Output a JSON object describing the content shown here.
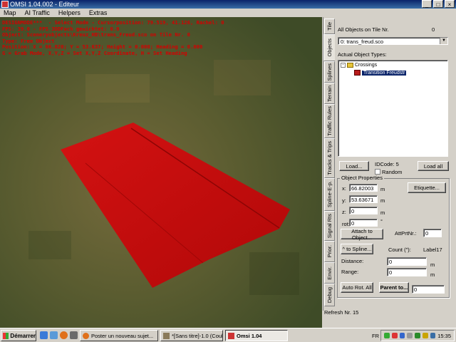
{
  "window": {
    "title": "OMSI 1.04.002 - Editeur",
    "minimize": "_",
    "maximize": "□",
    "close": "×"
  },
  "menu": [
    "Map",
    "AI Traffic",
    "Helpers",
    "Extras"
  ],
  "overlay": {
    "lines": [
      "DESIGNMODE***  - Select Mode - Cursorposition: 79.519, 41.126, Rachel: 0",
      "FPS: 39.0 - FPS 3DDFach gewichtet: 0.0",
      "Object: Sceneryobjects\\Kreuz_HB\\trans_Freud.sco on Tile Nr. 0",
      "Type: Free Object",
      "Position: X = 66.820; Y = 53.637; Height = 0.000; Heading = 0.000",
      "G = Grab Mode, X,Y,Z = Set X,Y,Z Coordinate, H = Set Heading"
    ]
  },
  "tabs": [
    "Tile",
    "Objects",
    "Splines",
    "Terrain",
    "Traffic Rules",
    "Tracks & Trips",
    "Spline-E-p.",
    "Signal Rts",
    "Prior.",
    "Envir.",
    "Debug"
  ],
  "panel": {
    "all_objects_label": "All Objects on Tile Nr.",
    "tile_number": "0",
    "object_combo": "0: trans_freud.sco",
    "actual_types_label": "Actual Object Types:",
    "tree": {
      "folder": "Crossings",
      "folder_expander": "-",
      "item": "Transition Freudstr"
    },
    "load_button": "Load...",
    "idcode_label": "IDCode: 5",
    "random_label": "Random",
    "load_all_button": "Load all",
    "props_title": "Object Properties",
    "x_label": "x:",
    "x_value": "66.82003",
    "y_label": "y:",
    "y_value": "53.63671",
    "z_label": "z:",
    "z_value": "0",
    "rot_label": "rot:",
    "rot_value": "0",
    "unit_m": "m",
    "unit_deg": "°",
    "etiquette_button": "Etiquette...",
    "attach_button": "Attach to Object...",
    "att_prt_label": "AttPrtNr.:",
    "att_prt_value": "0",
    "to_spline_button": "^ to Spline...",
    "count_label": "Count (\"):",
    "label17": "Label17",
    "distance_label": "Distance:",
    "distance_value": "0",
    "range_label": "Range:",
    "range_value": "0",
    "auto_rot_button": "Auto Rot. All",
    "parent_button": "Parent to...",
    "parent_value": "0",
    "refresh_label": "Refresh Nr. 15"
  },
  "taskbar": {
    "start": "Démarrer",
    "tasks": [
      {
        "label": "Poster un nouveau sujet..."
      },
      {
        "label": "*[Sans titre]-1.0 (Couleu..."
      },
      {
        "label": "Omsi 1.04"
      }
    ],
    "lang": "FR",
    "clock": "15:35"
  },
  "colors": {
    "object_red": "#c40c0c",
    "overlay_text": "#d40000",
    "selection": "#0a246a"
  }
}
